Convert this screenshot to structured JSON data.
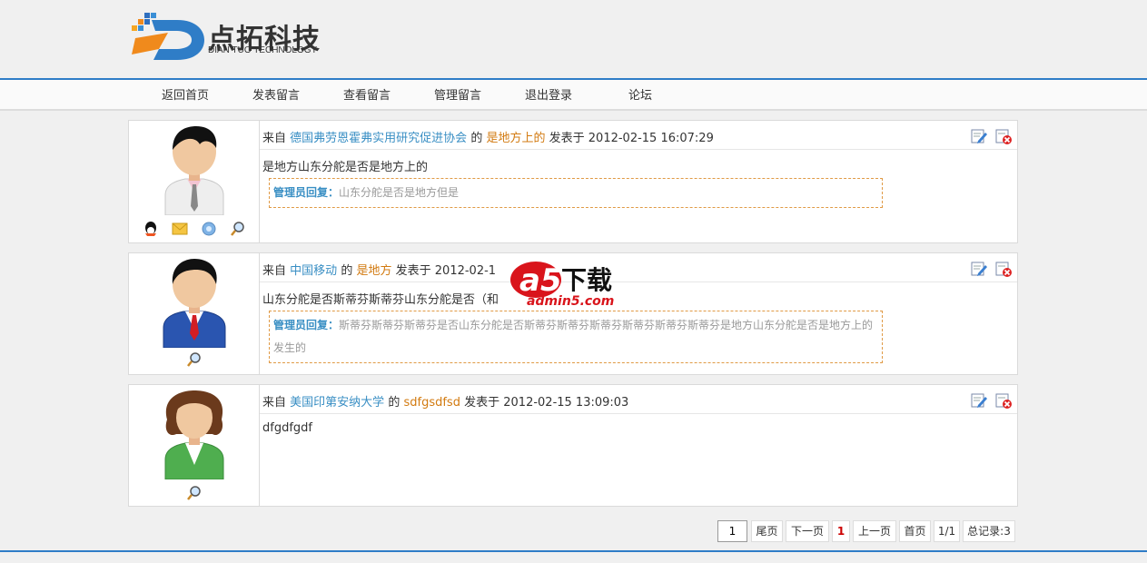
{
  "brand": {
    "name_cn": "点拓科技",
    "name_en": "DIAN TUO TECHNOLOGY"
  },
  "nav": {
    "items": [
      "返回首页",
      "发表留言",
      "查看留言",
      "管理留言",
      "退出登录",
      "论坛"
    ]
  },
  "posts": [
    {
      "from_label": "来自",
      "source": "德国弗劳恩霍弗实用研究促进协会",
      "of_label": "的",
      "author": "是地方上的",
      "posted_label": "发表于",
      "date": "2012-02-15 16:07:29",
      "content": "是地方山东分舵是否是地方上的",
      "reply_label": "管理员回复：",
      "reply": "山东分舵是否是地方但是"
    },
    {
      "from_label": "来自",
      "source": "中国移动",
      "of_label": "的",
      "author": "是地方",
      "posted_label": "发表于",
      "date": "2012-02-1",
      "content": "山东分舵是否斯蒂芬斯蒂芬山东分舵是否（和",
      "reply_label": "管理员回复：",
      "reply": "斯蒂芬斯蒂芬斯蒂芬是否山东分舵是否斯蒂芬斯蒂芬斯蒂芬斯蒂芬斯蒂芬斯蒂芬是地方山东分舵是否是地方上的发生的"
    },
    {
      "from_label": "来自",
      "source": "美国印第安纳大学",
      "of_label": "的",
      "author": "sdfgsdfsd",
      "posted_label": "发表于",
      "date": "2012-02-15 13:09:03",
      "content": "dfgdfgdf"
    }
  ],
  "pager": {
    "page_input": "1",
    "last": "尾页",
    "next": "下一页",
    "current": "1",
    "prev": "上一页",
    "first": "首页",
    "page_of": "1/1",
    "total": "总记录:3"
  },
  "watermark": {
    "logo_text": "a5下载",
    "site": "admin5.com"
  },
  "colors": {
    "accent_blue": "#2f7dc7",
    "link_blue": "#3a8fc4",
    "author_orange": "#d27a10",
    "reply_border": "#e09a45"
  }
}
